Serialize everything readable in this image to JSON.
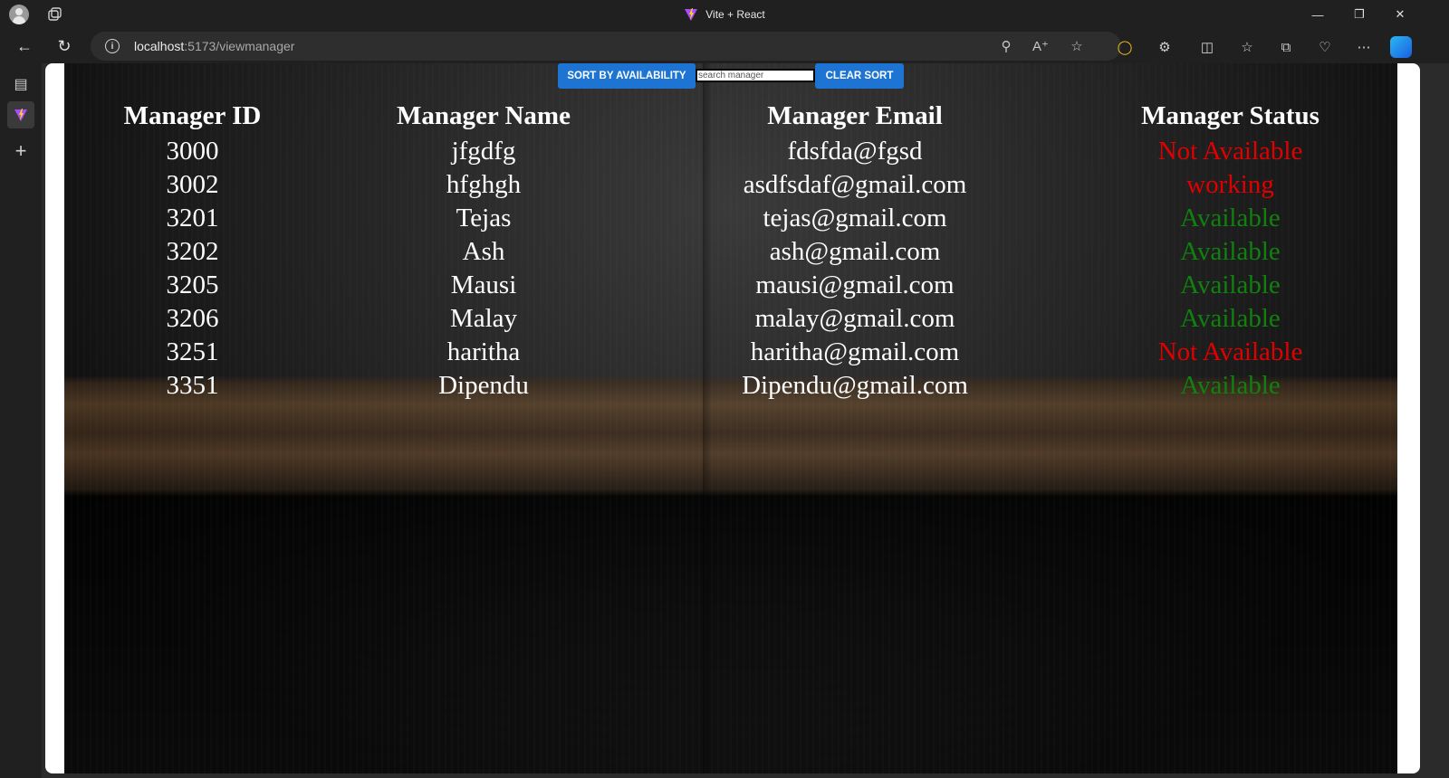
{
  "window": {
    "title": "Vite + React"
  },
  "addressbar": {
    "url_host": "localhost",
    "url_rest": ":5173/viewmanager"
  },
  "controls": {
    "sort_label": "SORT BY AVAILABILITY",
    "search_placeholder": "search manager",
    "search_value": "",
    "clear_label": "CLEAR SORT"
  },
  "table": {
    "headers": [
      "Manager ID",
      "Manager Name",
      "Manager Email",
      "Manager Status"
    ],
    "rows": [
      {
        "id": "3000",
        "name": "jfgdfg",
        "email": "fdsfda@fgsd",
        "status": "Not Available"
      },
      {
        "id": "3002",
        "name": "hfghgh",
        "email": "asdfsdaf@gmail.com",
        "status": "working"
      },
      {
        "id": "3201",
        "name": "Tejas",
        "email": "tejas@gmail.com",
        "status": "Available"
      },
      {
        "id": "3202",
        "name": "Ash",
        "email": "ash@gmail.com",
        "status": "Available"
      },
      {
        "id": "3205",
        "name": "Mausi",
        "email": "mausi@gmail.com",
        "status": "Available"
      },
      {
        "id": "3206",
        "name": "Malay",
        "email": "malay@gmail.com",
        "status": "Available"
      },
      {
        "id": "3251",
        "name": "haritha",
        "email": "haritha@gmail.com",
        "status": "Not Available"
      },
      {
        "id": "3351",
        "name": "Dipendu",
        "email": "Dipendu@gmail.com",
        "status": "Available"
      }
    ]
  },
  "colors": {
    "status_available": "#10800f",
    "status_unavailable": "#e00000",
    "button": "#1e74d2"
  }
}
